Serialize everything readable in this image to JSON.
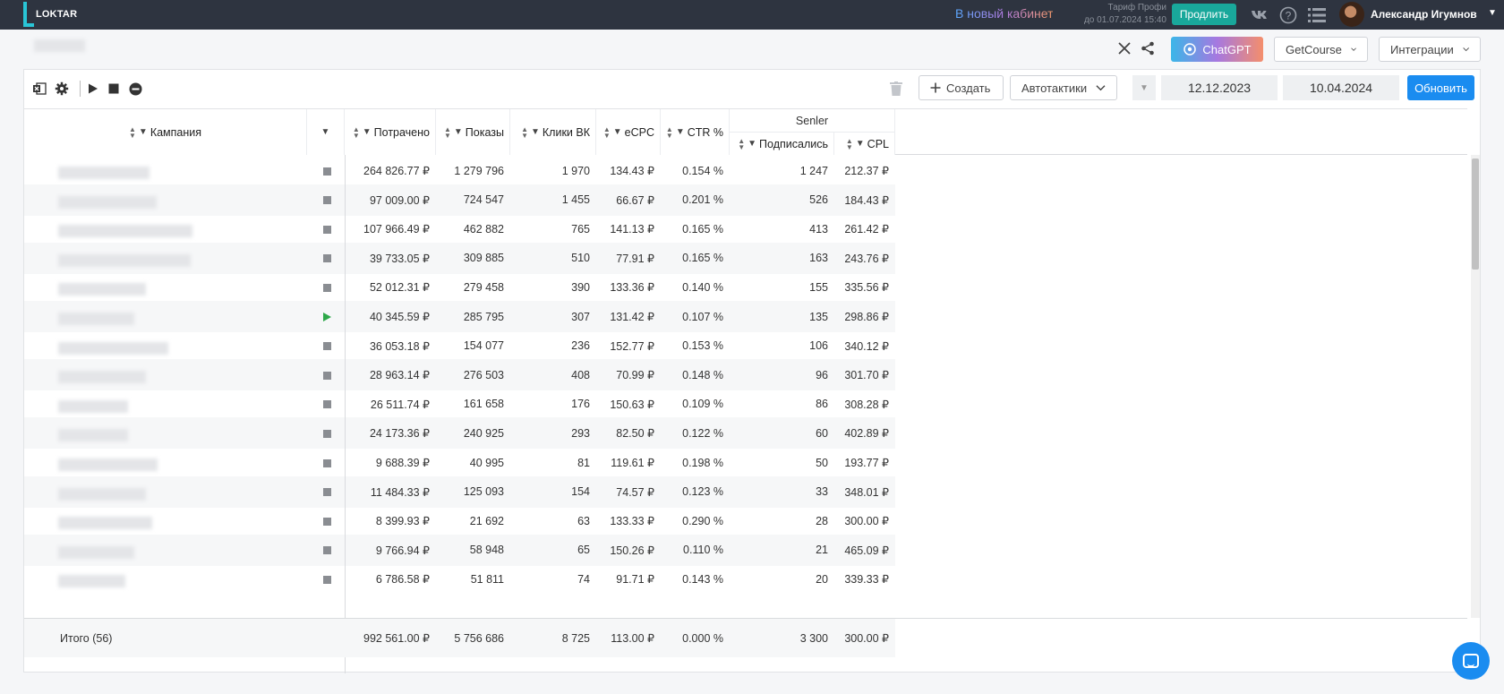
{
  "topbar": {
    "logo_text": "LOKTAR",
    "new_cabinet": "В новый кабинет",
    "tariff_line1": "Тариф Профи",
    "tariff_line2": "до 01.07.2024 15:40",
    "renew_label": "Продлить",
    "user_name": "Александр Игумнов",
    "icons": [
      "vk-icon",
      "help-icon",
      "menu-list-icon"
    ]
  },
  "header": {
    "chatgpt_label": "ChatGPT",
    "getcourse_label": "GetCourse",
    "integrations_label": "Интеграции"
  },
  "toolbar": {
    "create_label": "Создать",
    "autotactics_label": "Автотактики",
    "date_from": "12.12.2023",
    "date_to": "10.04.2024",
    "refresh_label": "Обновить"
  },
  "table": {
    "columns": {
      "campaign": "Кампания",
      "spent": "Потрачено",
      "impressions": "Показы",
      "clicks": "Клики ВК",
      "ecpc": "eCPC",
      "ctr": "CTR %",
      "group": "Senler",
      "subscribed": "Подписались",
      "cpl": "CPL"
    },
    "rows": [
      {
        "status": "stopped",
        "spent": "264 826.77 ₽",
        "impressions": "1 279 796",
        "clicks": "1 970",
        "ecpc": "134.43 ₽",
        "ctr": "0.154 %",
        "subscribed": "1 247",
        "cpl": "212.37 ₽"
      },
      {
        "status": "stopped",
        "spent": "97 009.00 ₽",
        "impressions": "724 547",
        "clicks": "1 455",
        "ecpc": "66.67 ₽",
        "ctr": "0.201 %",
        "subscribed": "526",
        "cpl": "184.43 ₽"
      },
      {
        "status": "stopped",
        "spent": "107 966.49 ₽",
        "impressions": "462 882",
        "clicks": "765",
        "ecpc": "141.13 ₽",
        "ctr": "0.165 %",
        "subscribed": "413",
        "cpl": "261.42 ₽"
      },
      {
        "status": "stopped",
        "spent": "39 733.05 ₽",
        "impressions": "309 885",
        "clicks": "510",
        "ecpc": "77.91 ₽",
        "ctr": "0.165 %",
        "subscribed": "163",
        "cpl": "243.76 ₽"
      },
      {
        "status": "stopped",
        "spent": "52 012.31 ₽",
        "impressions": "279 458",
        "clicks": "390",
        "ecpc": "133.36 ₽",
        "ctr": "0.140 %",
        "subscribed": "155",
        "cpl": "335.56 ₽"
      },
      {
        "status": "running",
        "spent": "40 345.59 ₽",
        "impressions": "285 795",
        "clicks": "307",
        "ecpc": "131.42 ₽",
        "ctr": "0.107 %",
        "subscribed": "135",
        "cpl": "298.86 ₽"
      },
      {
        "status": "stopped",
        "spent": "36 053.18 ₽",
        "impressions": "154 077",
        "clicks": "236",
        "ecpc": "152.77 ₽",
        "ctr": "0.153 %",
        "subscribed": "106",
        "cpl": "340.12 ₽"
      },
      {
        "status": "stopped",
        "spent": "28 963.14 ₽",
        "impressions": "276 503",
        "clicks": "408",
        "ecpc": "70.99 ₽",
        "ctr": "0.148 %",
        "subscribed": "96",
        "cpl": "301.70 ₽"
      },
      {
        "status": "stopped",
        "spent": "26 511.74 ₽",
        "impressions": "161 658",
        "clicks": "176",
        "ecpc": "150.63 ₽",
        "ctr": "0.109 %",
        "subscribed": "86",
        "cpl": "308.28 ₽"
      },
      {
        "status": "stopped",
        "spent": "24 173.36 ₽",
        "impressions": "240 925",
        "clicks": "293",
        "ecpc": "82.50 ₽",
        "ctr": "0.122 %",
        "subscribed": "60",
        "cpl": "402.89 ₽"
      },
      {
        "status": "stopped",
        "spent": "9 688.39 ₽",
        "impressions": "40 995",
        "clicks": "81",
        "ecpc": "119.61 ₽",
        "ctr": "0.198 %",
        "subscribed": "50",
        "cpl": "193.77 ₽"
      },
      {
        "status": "stopped",
        "spent": "11 484.33 ₽",
        "impressions": "125 093",
        "clicks": "154",
        "ecpc": "74.57 ₽",
        "ctr": "0.123 %",
        "subscribed": "33",
        "cpl": "348.01 ₽"
      },
      {
        "status": "stopped",
        "spent": "8 399.93 ₽",
        "impressions": "21 692",
        "clicks": "63",
        "ecpc": "133.33 ₽",
        "ctr": "0.290 %",
        "subscribed": "28",
        "cpl": "300.00 ₽"
      },
      {
        "status": "stopped",
        "spent": "9 766.94 ₽",
        "impressions": "58 948",
        "clicks": "65",
        "ecpc": "150.26 ₽",
        "ctr": "0.110 %",
        "subscribed": "21",
        "cpl": "465.09 ₽"
      },
      {
        "status": "stopped",
        "spent": "6 786.58 ₽",
        "impressions": "51 811",
        "clicks": "74",
        "ecpc": "91.71 ₽",
        "ctr": "0.143 %",
        "subscribed": "20",
        "cpl": "339.33 ₽"
      }
    ],
    "totals": {
      "label": "Итого (56)",
      "spent": "992 561.00 ₽",
      "impressions": "5 756 686",
      "clicks": "8 725",
      "ecpc": "113.00 ₽",
      "ctr": "0.000 %",
      "subscribed": "3 300",
      "cpl": "300.00 ₽"
    }
  }
}
